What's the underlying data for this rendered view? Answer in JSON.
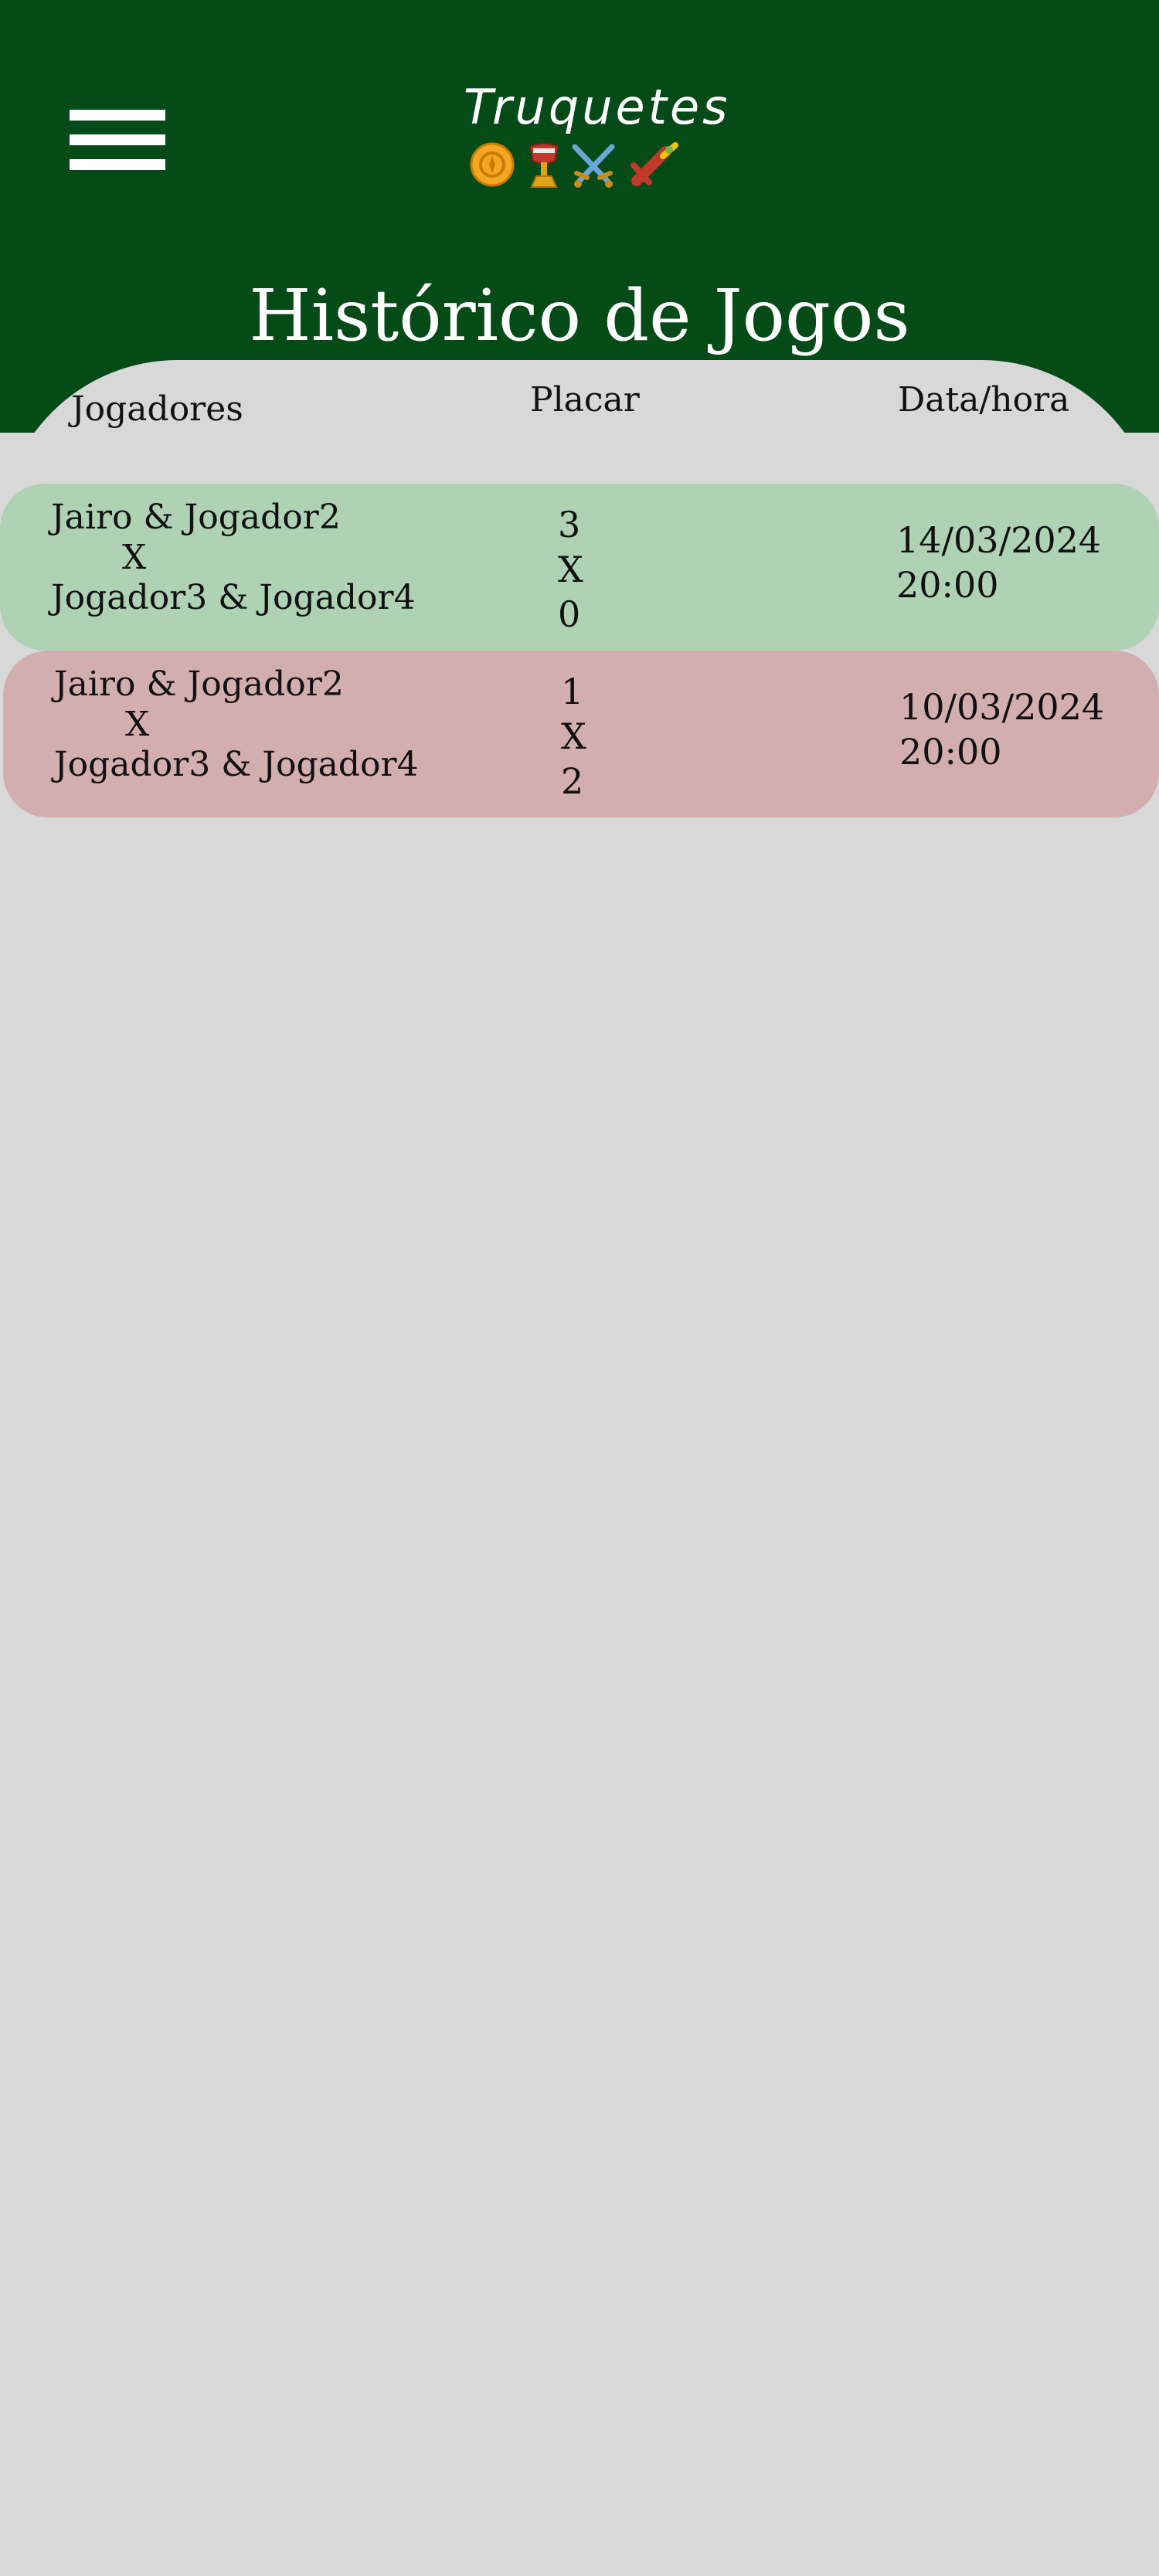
{
  "app": {
    "logo_text": "Truquetes"
  },
  "page": {
    "title": "Histórico de Jogos"
  },
  "icons": {
    "menu": "hamburger-menu-icon",
    "logo_icons": [
      "gold-coin-icon",
      "cup-icon",
      "crossed-swords-icon",
      "club-icon"
    ]
  },
  "colors": {
    "header": "#054b18",
    "background": "#d8d8d8",
    "win_row": "#afd1b4",
    "loss_row": "#d3aeaf"
  },
  "table": {
    "headers": {
      "players": "Jogadores",
      "score": "Placar",
      "datetime": "Data/hora"
    },
    "games": [
      {
        "result": "win",
        "team1": "Jairo & Jogador2",
        "vs": "X",
        "team2": "Jogador3 & Jogador4",
        "score1": "3",
        "score_sep": "X",
        "score2": "0",
        "date": "14/03/2024",
        "time": "20:00"
      },
      {
        "result": "loss",
        "team1": "Jairo & Jogador2",
        "vs": "X",
        "team2": "Jogador3 & Jogador4",
        "score1": "1",
        "score_sep": "X",
        "score2": "2",
        "date": "10/03/2024",
        "time": "20:00"
      }
    ]
  }
}
